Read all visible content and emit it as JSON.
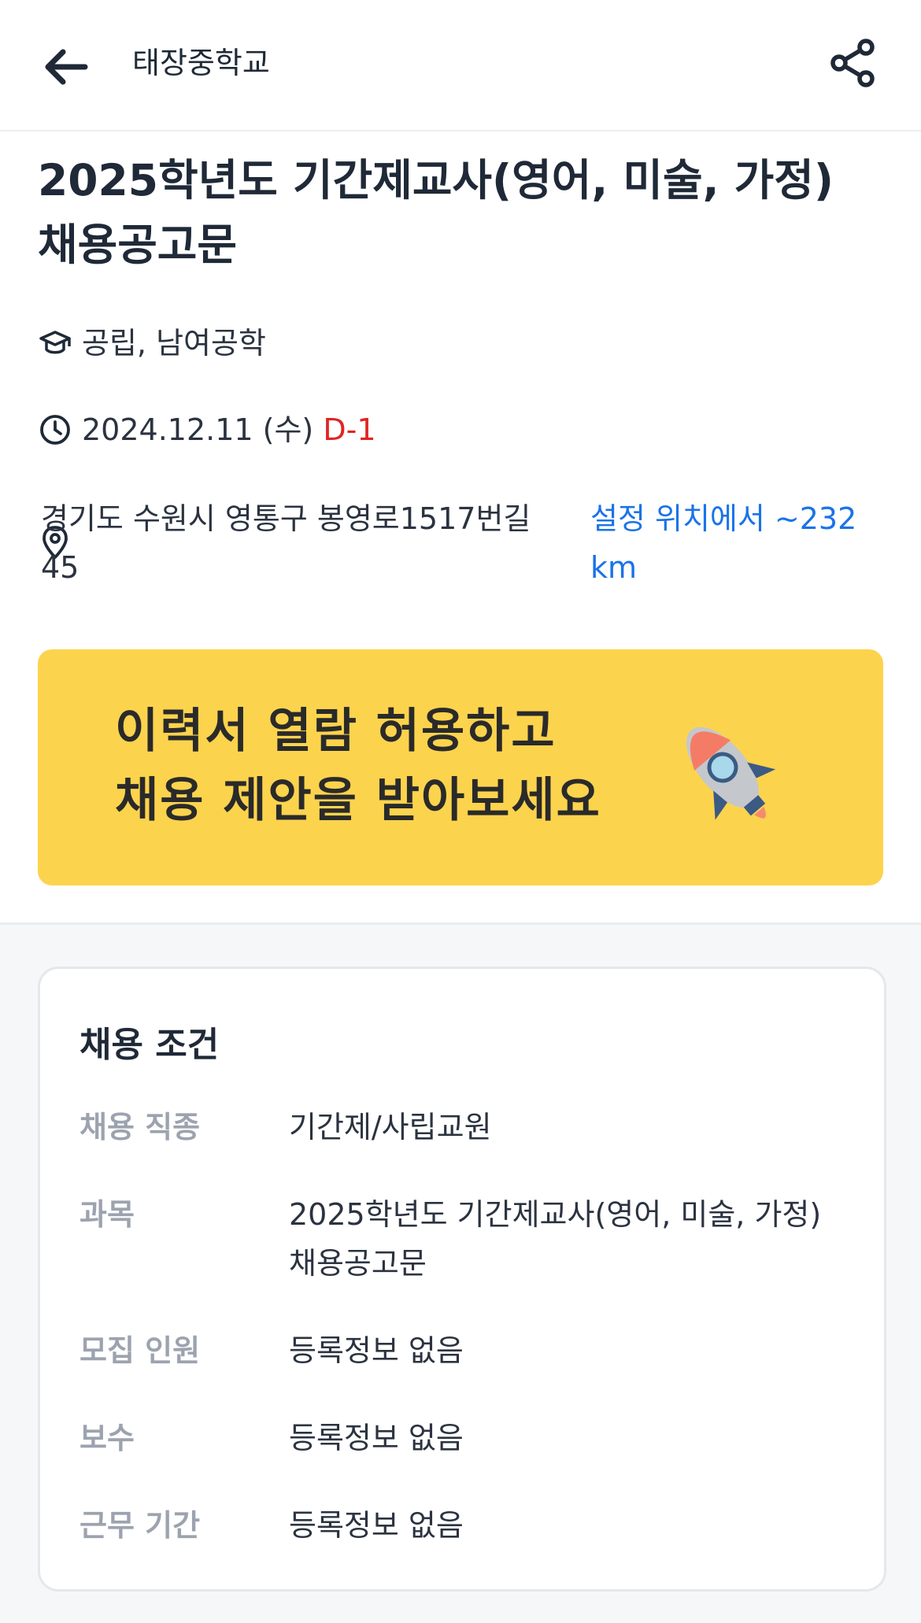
{
  "header": {
    "title": "태장중학교"
  },
  "job": {
    "title": "2025학년도 기간제교사(영어, 미술, 가정) 채용공고문",
    "school_type": "공립, 남여공학",
    "deadline_date": "2024.12.11 (수)",
    "dday": "D-1",
    "address": "경기도 수원시 영통구 봉영로1517번길 45",
    "distance": "설정 위치에서 ~232 km"
  },
  "banner": {
    "line1": "이력서 열람 허용하고",
    "line2": "채용 제안을 받아보세요"
  },
  "conditions": {
    "title": "채용 조건",
    "rows": [
      {
        "label": "채용 직종",
        "value": "기간제/사립교원"
      },
      {
        "label": "과목",
        "value": "2025학년도 기간제교사(영어, 미술, 가정) 채용공고문"
      },
      {
        "label": "모집 인원",
        "value": "등록정보 없음"
      },
      {
        "label": "보수",
        "value": "등록정보 없음"
      },
      {
        "label": "근무 기간",
        "value": "등록정보 없음"
      }
    ]
  },
  "colors": {
    "accent_blue": "#1a73e8",
    "dday_red": "#e02424",
    "banner_yellow": "#fcd34d"
  }
}
